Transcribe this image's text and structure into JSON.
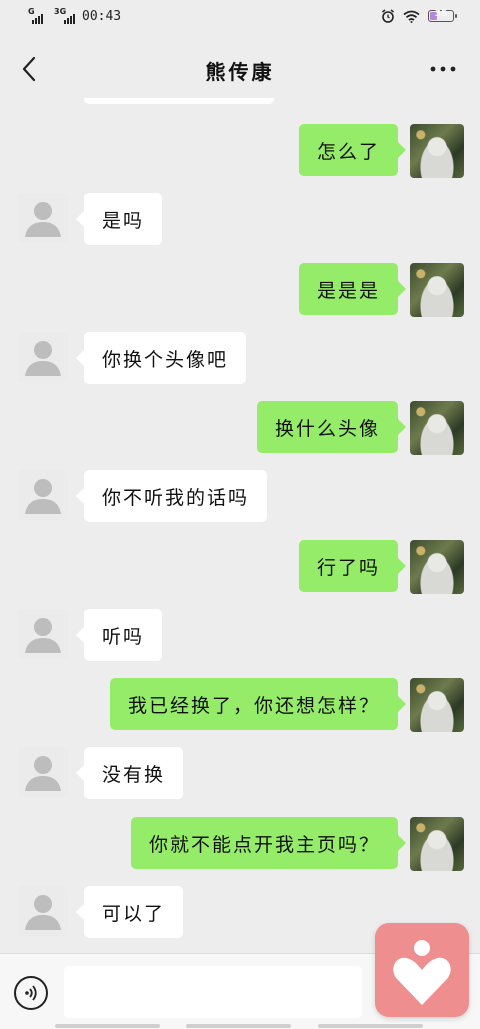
{
  "status_bar": {
    "signal1_label": "G",
    "signal2_label": "3G",
    "time": "00:43",
    "battery_percent": "35",
    "battery_color": "#b388d8"
  },
  "header": {
    "title": "熊传康",
    "back_icon": "chevron-left-icon",
    "more_icon": "more-dots-icon"
  },
  "messages": [
    {
      "side": "right",
      "text": "怎么了"
    },
    {
      "side": "left",
      "text": "是吗"
    },
    {
      "side": "right",
      "text": "是是是"
    },
    {
      "side": "left",
      "text": "你换个头像吧"
    },
    {
      "side": "right",
      "text": "换什么头像"
    },
    {
      "side": "left",
      "text": "你不听我的话吗"
    },
    {
      "side": "right",
      "text": "行了吗"
    },
    {
      "side": "left",
      "text": "听吗"
    },
    {
      "side": "right",
      "text": "我已经换了，你还想怎样？"
    },
    {
      "side": "left",
      "text": "没有换"
    },
    {
      "side": "right",
      "text": "你就不能点开我主页吗？"
    },
    {
      "side": "left",
      "text": "可以了"
    }
  ],
  "input_bar": {
    "voice_icon": "voice-input-icon",
    "input_value": "",
    "floating_app_icon": "heart-person-icon"
  },
  "colors": {
    "background": "#ededed",
    "sent_bubble": "#95ec69",
    "received_bubble": "#ffffff",
    "floating_app": "#ee8e8e"
  }
}
